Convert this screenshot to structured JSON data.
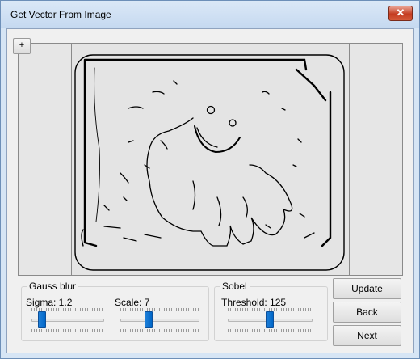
{
  "window": {
    "title": "Get Vector From Image",
    "close_glyph": "✕"
  },
  "toolbar": {
    "plus_label": "+"
  },
  "gauss": {
    "label": "Gauss blur",
    "sigma_label": "Sigma: 1.2",
    "sigma_position": 0.12,
    "scale_label": "Scale: 7",
    "scale_position": 0.35
  },
  "sobel": {
    "label": "Sobel",
    "threshold_label": "Threshold: 125",
    "threshold_position": 0.5
  },
  "buttons": {
    "update": "Update",
    "back": "Back",
    "next": "Next"
  },
  "colors": {
    "slider_thumb": "#0067c8",
    "close_button": "#c43b20"
  }
}
